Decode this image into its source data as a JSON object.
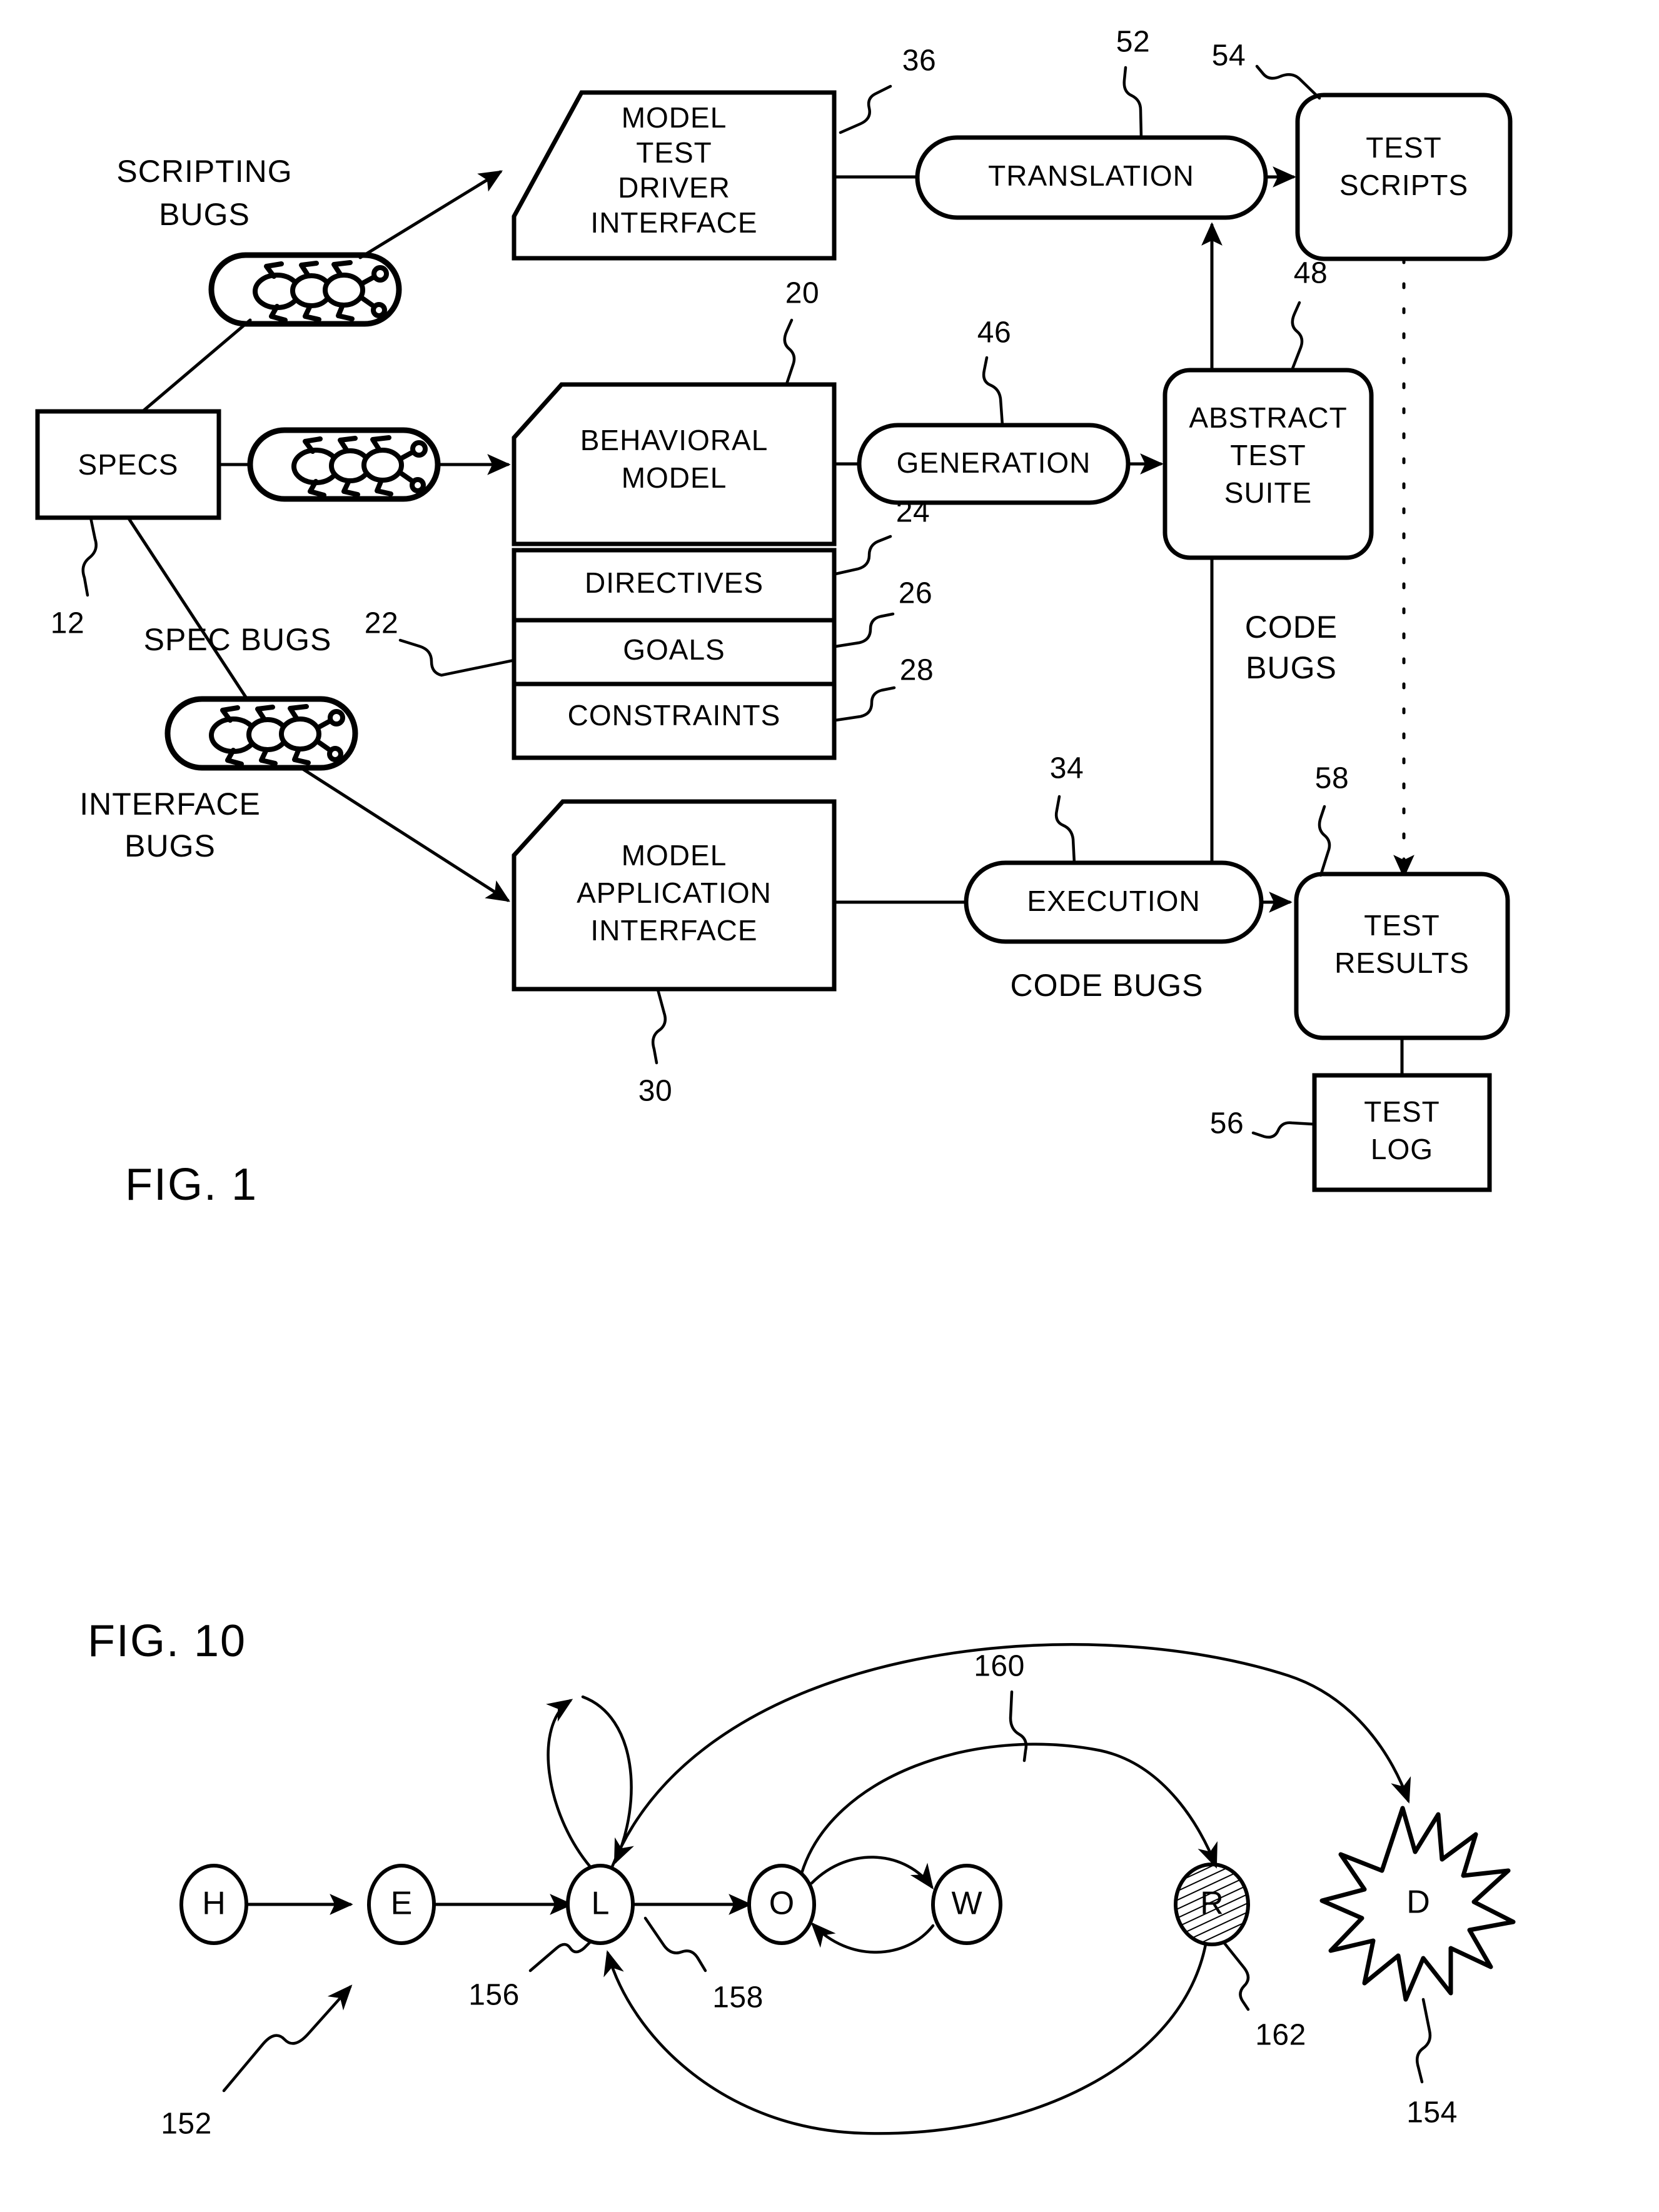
{
  "figures": [
    {
      "id": "fig1",
      "title": "FIG. 1",
      "boxes": {
        "specs": "SPECS",
        "model_test_driver_interface": [
          "MODEL",
          "TEST",
          "DRIVER",
          "INTERFACE"
        ],
        "behavioral_model": [
          "BEHAVIORAL",
          "MODEL"
        ],
        "directives": "DIRECTIVES",
        "goals": "GOALS",
        "constraints": "CONSTRAINTS",
        "model_application_interface": [
          "MODEL",
          "APPLICATION",
          "INTERFACE"
        ],
        "translation": "TRANSLATION",
        "generation": "GENERATION",
        "execution": "EXECUTION",
        "test_scripts": [
          "TEST",
          "SCRIPTS"
        ],
        "abstract_test_suite": [
          "ABSTRACT",
          "TEST",
          "SUITE"
        ],
        "test_results": [
          "TEST",
          "RESULTS"
        ],
        "test_log": [
          "TEST",
          "LOG"
        ]
      },
      "bug_labels": {
        "scripting_bugs": [
          "SCRIPTING",
          "BUGS"
        ],
        "spec_bugs": "SPEC BUGS",
        "interface_bugs": [
          "INTERFACE",
          "BUGS"
        ],
        "code_bugs_exec": "CODE BUGS",
        "code_bugs_scripts": [
          "CODE",
          "BUGS"
        ]
      },
      "reference_numerals": {
        "specs": "12",
        "behavioral_model": "20",
        "test_directives_group": "22",
        "directives": "24",
        "goals": "26",
        "constraints": "28",
        "model_application_interface": "30",
        "execution": "34",
        "model_test_driver_interface": "36",
        "generation": "46",
        "abstract_test_suite": "48",
        "translation": "52",
        "test_scripts": "54",
        "test_log": "56",
        "test_results": "58"
      }
    },
    {
      "id": "fig10",
      "title": "FIG. 10",
      "nodes": [
        {
          "label": "H",
          "shape": "ellipse"
        },
        {
          "label": "E",
          "shape": "ellipse"
        },
        {
          "label": "L",
          "shape": "ellipse"
        },
        {
          "label": "O",
          "shape": "ellipse"
        },
        {
          "label": "W",
          "shape": "ellipse"
        },
        {
          "label": "R",
          "shape": "hatched-ellipse"
        },
        {
          "label": "D",
          "shape": "starburst"
        }
      ],
      "reference_numerals": {
        "graph": "152",
        "final_state": "154",
        "state_node": "156",
        "transition": "158",
        "long_transition": "160",
        "hatched_node": "162"
      }
    }
  ]
}
